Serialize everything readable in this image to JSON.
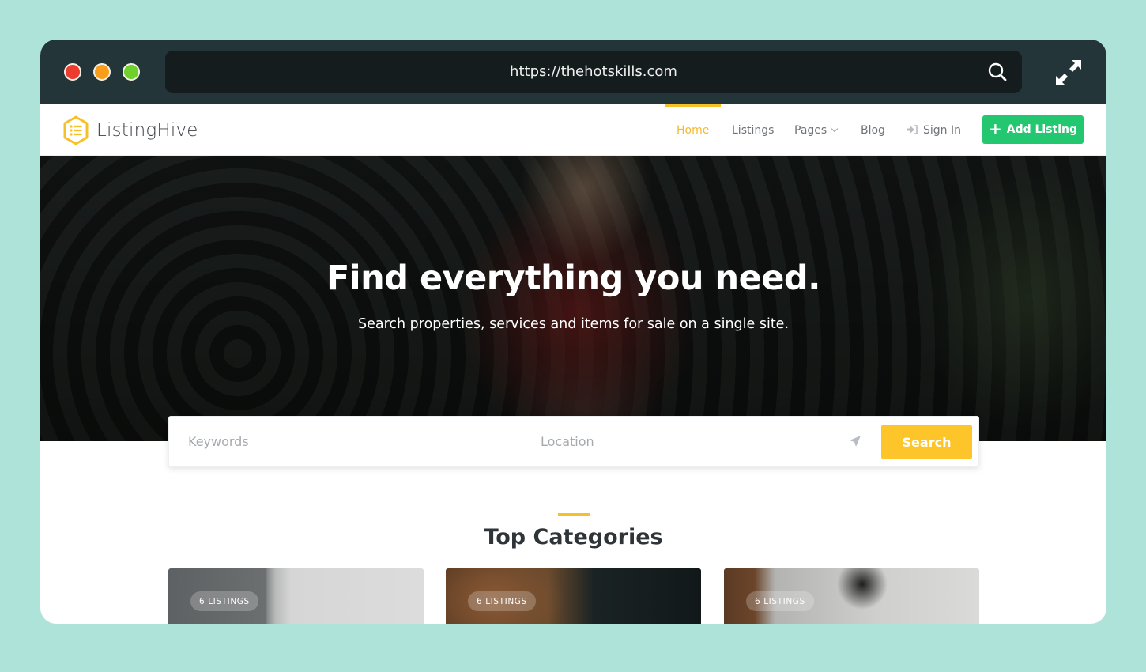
{
  "browser": {
    "url": "https://thehotskills.com",
    "traffic_lights": {
      "close": "#ec3c30",
      "minimize": "#f99e1a",
      "maximize": "#6fcf2b"
    },
    "icons": {
      "search": "search-icon",
      "expand": "expand-icon"
    }
  },
  "navbar": {
    "logo_text": "ListingHive",
    "items": [
      {
        "label": "Home",
        "active": true
      },
      {
        "label": "Listings",
        "active": false
      },
      {
        "label": "Pages",
        "active": false,
        "has_dropdown": true
      },
      {
        "label": "Blog",
        "active": false
      }
    ],
    "sign_in_label": "Sign In",
    "add_listing_label": "Add Listing",
    "colors": {
      "accent": "#f5c12a",
      "add_button": "#22c76f"
    }
  },
  "hero": {
    "title": "Find everything you need.",
    "subtitle": "Search properties, services and items for sale on a single site."
  },
  "search": {
    "keywords_placeholder": "Keywords",
    "location_placeholder": "Location",
    "button_label": "Search",
    "button_color": "#fec52a"
  },
  "categories": {
    "title": "Top Categories",
    "cards": [
      {
        "badge": "6 LISTINGS"
      },
      {
        "badge": "6 LISTINGS"
      },
      {
        "badge": "6 LISTINGS"
      }
    ]
  }
}
